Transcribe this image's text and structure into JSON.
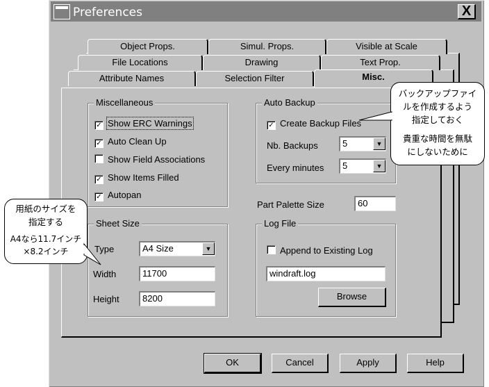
{
  "window": {
    "title": "Preferences",
    "close_label": "X"
  },
  "tabs": {
    "row1": [
      "Object Props.",
      "Simul. Props.",
      "Visible at Scale"
    ],
    "row2": [
      "File Locations",
      "Drawing",
      "Text Prop."
    ],
    "row3": [
      "Attribute Names",
      "Selection Filter",
      "Misc."
    ]
  },
  "misc_group": {
    "title": "Miscellaneous",
    "items": [
      {
        "label": "Show ERC Warnings",
        "checked": true
      },
      {
        "label": "Auto Clean Up",
        "checked": true
      },
      {
        "label": "Show Field Associations",
        "checked": false
      },
      {
        "label": "Show Items Filled",
        "checked": true
      },
      {
        "label": "Autopan",
        "checked": true
      }
    ]
  },
  "auto_backup": {
    "title": "Auto Backup",
    "create_label": "Create Backup Files",
    "create_checked": true,
    "nb_label": "Nb. Backups",
    "nb_value": "5",
    "every_label": "Every minutes",
    "every_value": "5"
  },
  "part_palette": {
    "label": "Part Palette Size",
    "value": "60"
  },
  "sheet_size": {
    "title": "Sheet Size",
    "type_label": "Type",
    "type_value": "A4 Size",
    "width_label": "Width",
    "width_value": "11700",
    "height_label": "Height",
    "height_value": "8200"
  },
  "log_file": {
    "title": "Log File",
    "append_label": "Append to Existing Log",
    "append_checked": false,
    "file_value": "windraft.log",
    "browse_label": "Browse"
  },
  "buttons": {
    "ok": "OK",
    "cancel": "Cancel",
    "apply": "Apply",
    "help": "Help"
  },
  "callouts": {
    "backup_line1": "バックアップファイ",
    "backup_line2": "ルを作成するよう",
    "backup_line3": "指定しておく",
    "backup_line4": "貴重な時間を無駄",
    "backup_line5": "にしないために",
    "sheet_line1": "用紙のサイズを",
    "sheet_line2": "指定する",
    "sheet_line3": "A4なら11.7インチ×8.2インチ"
  }
}
